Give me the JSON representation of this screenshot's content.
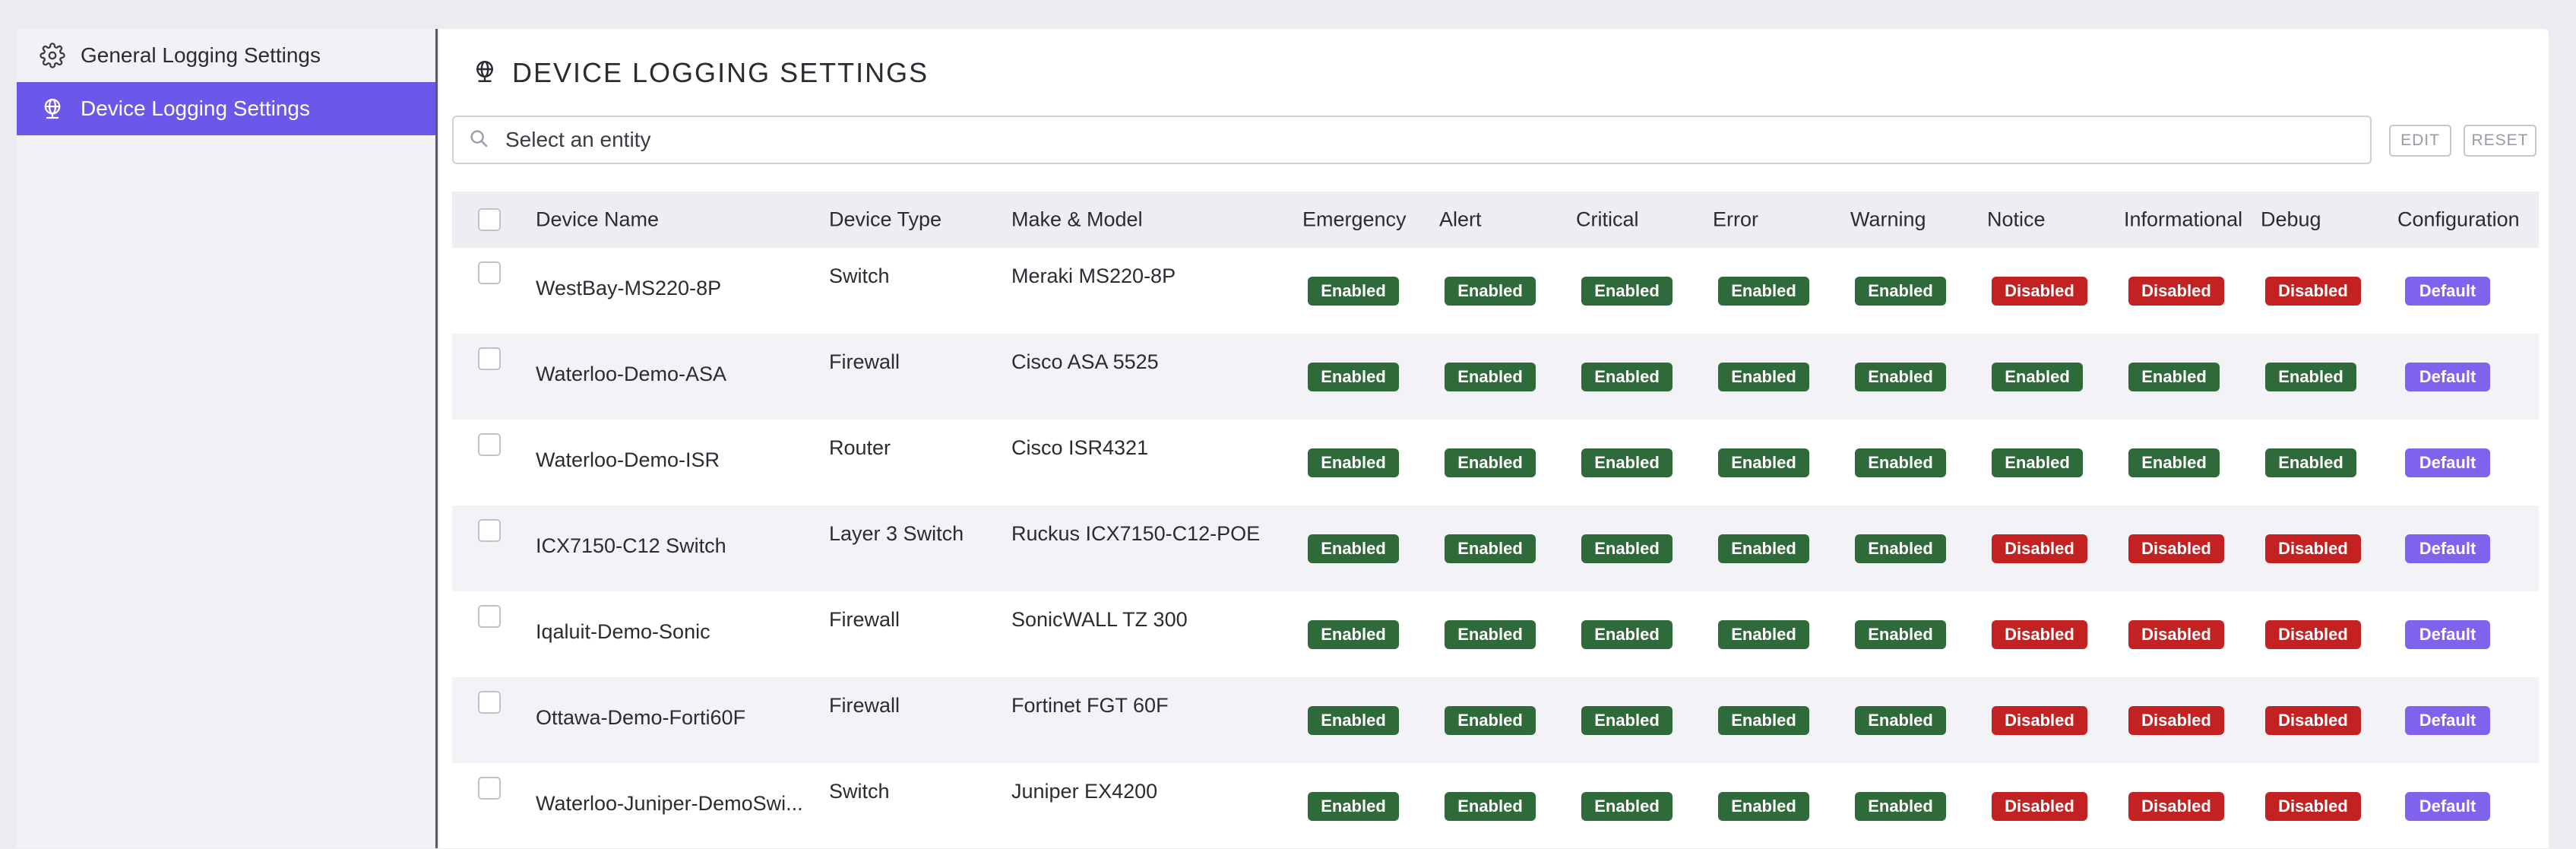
{
  "sidebar": {
    "items": [
      {
        "label": "General Logging Settings",
        "icon": "gear-icon"
      },
      {
        "label": "Device Logging Settings",
        "icon": "globe-icon"
      }
    ]
  },
  "header": {
    "title": "DEVICE LOGGING SETTINGS",
    "icon": "globe-icon"
  },
  "search": {
    "placeholder": "Select an entity"
  },
  "toolbar": {
    "edit_label": "EDIT",
    "reset_label": "RESET"
  },
  "colors": {
    "accent": "#6b57ea",
    "enabled": "#2f6b3a",
    "disabled": "#c42222",
    "default": "#7f63ec"
  },
  "table": {
    "columns": [
      "Device Name",
      "Device Type",
      "Make & Model",
      "Emergency",
      "Alert",
      "Critical",
      "Error",
      "Warning",
      "Notice",
      "Informational",
      "Debug",
      "Configuration"
    ],
    "rows": [
      {
        "name": "WestBay-MS220-8P",
        "type": "Switch",
        "model": "Meraki MS220-8P",
        "levels": [
          "Enabled",
          "Enabled",
          "Enabled",
          "Enabled",
          "Enabled",
          "Disabled",
          "Disabled",
          "Disabled"
        ],
        "configuration": "Default"
      },
      {
        "name": "Waterloo-Demo-ASA",
        "type": "Firewall",
        "model": "Cisco ASA 5525",
        "levels": [
          "Enabled",
          "Enabled",
          "Enabled",
          "Enabled",
          "Enabled",
          "Enabled",
          "Enabled",
          "Enabled"
        ],
        "configuration": "Default"
      },
      {
        "name": "Waterloo-Demo-ISR",
        "type": "Router",
        "model": "Cisco ISR4321",
        "levels": [
          "Enabled",
          "Enabled",
          "Enabled",
          "Enabled",
          "Enabled",
          "Enabled",
          "Enabled",
          "Enabled"
        ],
        "configuration": "Default"
      },
      {
        "name": "ICX7150-C12 Switch",
        "type": "Layer 3 Switch",
        "model": "Ruckus ICX7150-C12-POE",
        "levels": [
          "Enabled",
          "Enabled",
          "Enabled",
          "Enabled",
          "Enabled",
          "Disabled",
          "Disabled",
          "Disabled"
        ],
        "configuration": "Default"
      },
      {
        "name": "Iqaluit-Demo-Sonic",
        "type": "Firewall",
        "model": "SonicWALL TZ 300",
        "levels": [
          "Enabled",
          "Enabled",
          "Enabled",
          "Enabled",
          "Enabled",
          "Disabled",
          "Disabled",
          "Disabled"
        ],
        "configuration": "Default"
      },
      {
        "name": "Ottawa-Demo-Forti60F",
        "type": "Firewall",
        "model": "Fortinet FGT 60F",
        "levels": [
          "Enabled",
          "Enabled",
          "Enabled",
          "Enabled",
          "Enabled",
          "Disabled",
          "Disabled",
          "Disabled"
        ],
        "configuration": "Default"
      },
      {
        "name": "Waterloo-Juniper-DemoSwi...",
        "type": "Switch",
        "model": "Juniper EX4200",
        "levels": [
          "Enabled",
          "Enabled",
          "Enabled",
          "Enabled",
          "Enabled",
          "Disabled",
          "Disabled",
          "Disabled"
        ],
        "configuration": "Default"
      }
    ]
  }
}
